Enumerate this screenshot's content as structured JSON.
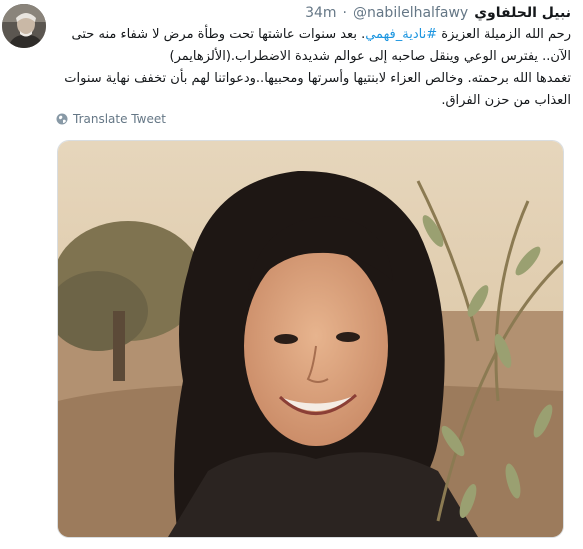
{
  "tweet": {
    "author_name": "نبيل الحلفاوي",
    "handle": "@nabilelhalfawy",
    "separator": "·",
    "time": "34m",
    "text_prefix": "رحم الله الزميلة العزيزة ",
    "hashtag": "#نادية_فهمي",
    "text_line1_rest": ". بعد سنوات عاشتها تحت وطأة مرض لا شفاء منه حتى الآن.. يفترس الوعي وينقل صاحبه إلى عوالم شديدة الاضطراب.(الألزهايمر)",
    "text_line2": "تغمدها الله برحمته. وخالص العزاء لابنتيها وأسرتها ومحبيها..ودعواتنا لهم بأن تخفف نهاية سنوات العذاب من حزن الفراق.",
    "translate_label": "Translate Tweet"
  },
  "icons": {
    "avatar": "profile-avatar",
    "translate": "globe-icon"
  },
  "colors": {
    "link": "#1b95e0",
    "muted": "#657786",
    "text": "#14171a"
  }
}
